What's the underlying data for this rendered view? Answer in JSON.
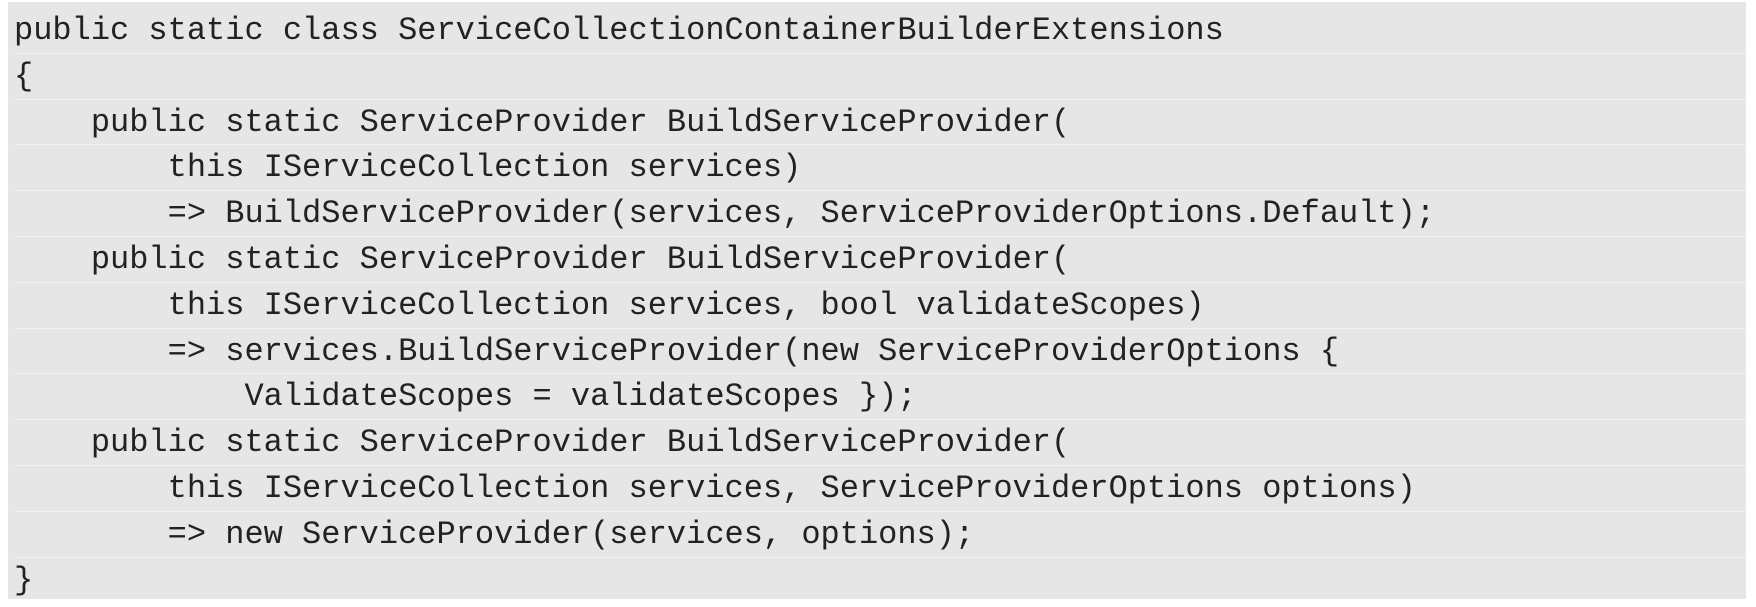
{
  "code": {
    "lines": [
      "public static class ServiceCollectionContainerBuilderExtensions",
      "{",
      "    public static ServiceProvider BuildServiceProvider(",
      "        this IServiceCollection services)",
      "        => BuildServiceProvider(services, ServiceProviderOptions.Default);",
      "    public static ServiceProvider BuildServiceProvider(",
      "        this IServiceCollection services, bool validateScopes)",
      "        => services.BuildServiceProvider(new ServiceProviderOptions {",
      "            ValidateScopes = validateScopes });",
      "    public static ServiceProvider BuildServiceProvider(",
      "        this IServiceCollection services, ServiceProviderOptions options)",
      "        => new ServiceProvider(services, options);",
      "}"
    ]
  }
}
